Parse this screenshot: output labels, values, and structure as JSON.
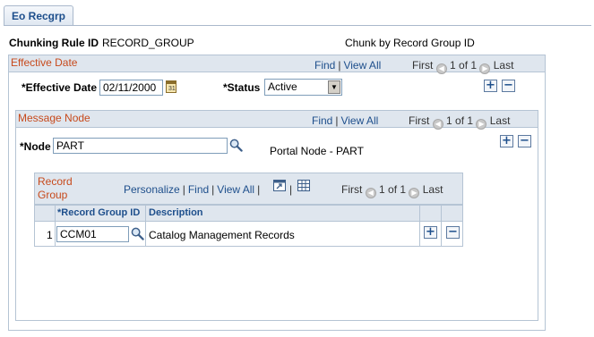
{
  "tab": {
    "label": "Eo Recgrp"
  },
  "header": {
    "rule_label": "Chunking Rule ID",
    "rule_value": "RECORD_GROUP",
    "rule_description": "Chunk by Record Group ID"
  },
  "effdt": {
    "title": "Effective Date",
    "nav": {
      "find": "Find",
      "view_all": "View All",
      "first": "First",
      "count": "1 of 1",
      "last": "Last"
    },
    "date_label": "*Effective Date",
    "date_value": "02/11/2000",
    "status_label": "*Status",
    "status_value": "Active"
  },
  "node": {
    "title": "Message Node",
    "nav": {
      "find": "Find",
      "view_all": "View All",
      "first": "First",
      "count": "1 of 1",
      "last": "Last"
    },
    "node_label": "*Node",
    "node_value": "PART",
    "node_description": "Portal Node - PART"
  },
  "recgrp": {
    "title_line1": "Record",
    "title_line2": "Group",
    "nav": {
      "personalize": "Personalize",
      "find": "Find",
      "view_all": "View All",
      "first": "First",
      "count": "1 of 1",
      "last": "Last"
    },
    "columns": [
      "*Record Group ID",
      "Description"
    ],
    "rows": [
      {
        "num": "1",
        "id": "CCM01",
        "description": "Catalog Management Records"
      }
    ]
  },
  "colors": {
    "link": "#1e4f8c",
    "title": "#c74a1c",
    "header_bg": "#dfe6ee",
    "border": "#b5c4d4"
  }
}
